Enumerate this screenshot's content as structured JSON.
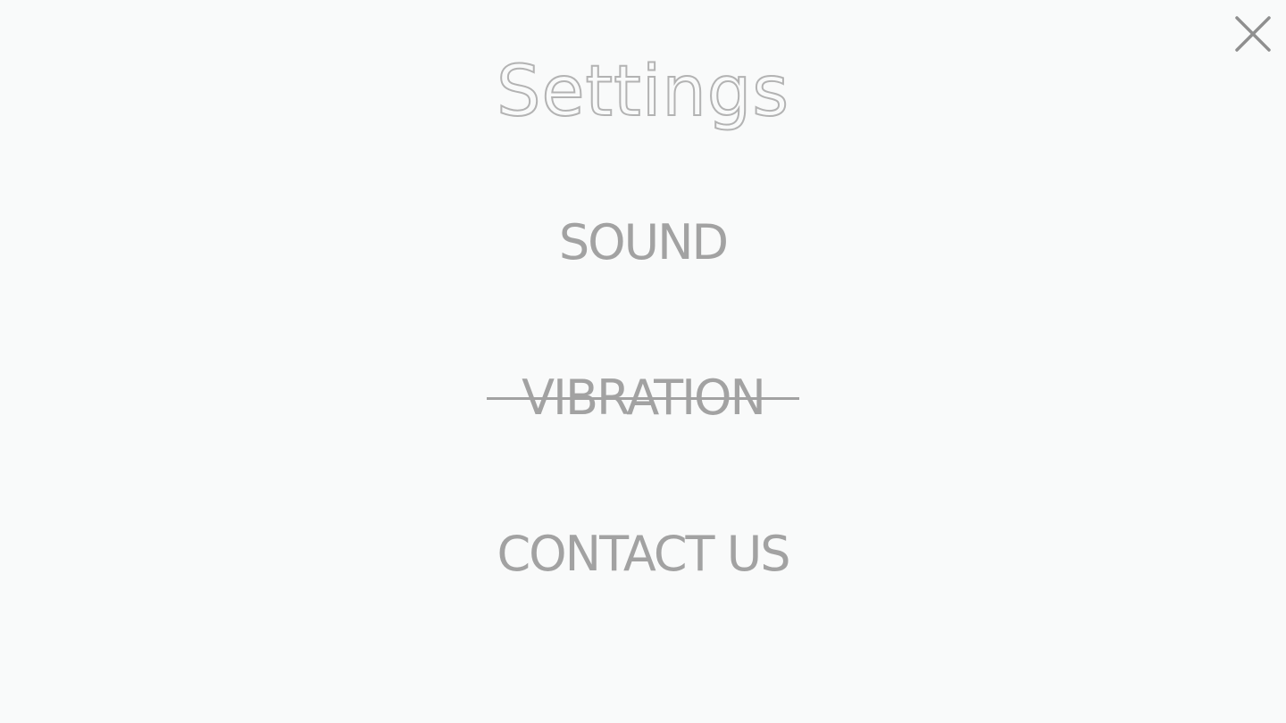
{
  "header": {
    "title": "Settings",
    "close_icon": "close-icon"
  },
  "menu": {
    "items": [
      {
        "label": "SOUND",
        "state": "on"
      },
      {
        "label": "VIBRATION",
        "state": "off"
      },
      {
        "label": "CONTACT US",
        "state": "link"
      }
    ]
  },
  "colors": {
    "background": "#f9fafa",
    "text": "#a2a2a2",
    "title_outline": "#b3b3b3",
    "icon": "#8f8f8f"
  }
}
